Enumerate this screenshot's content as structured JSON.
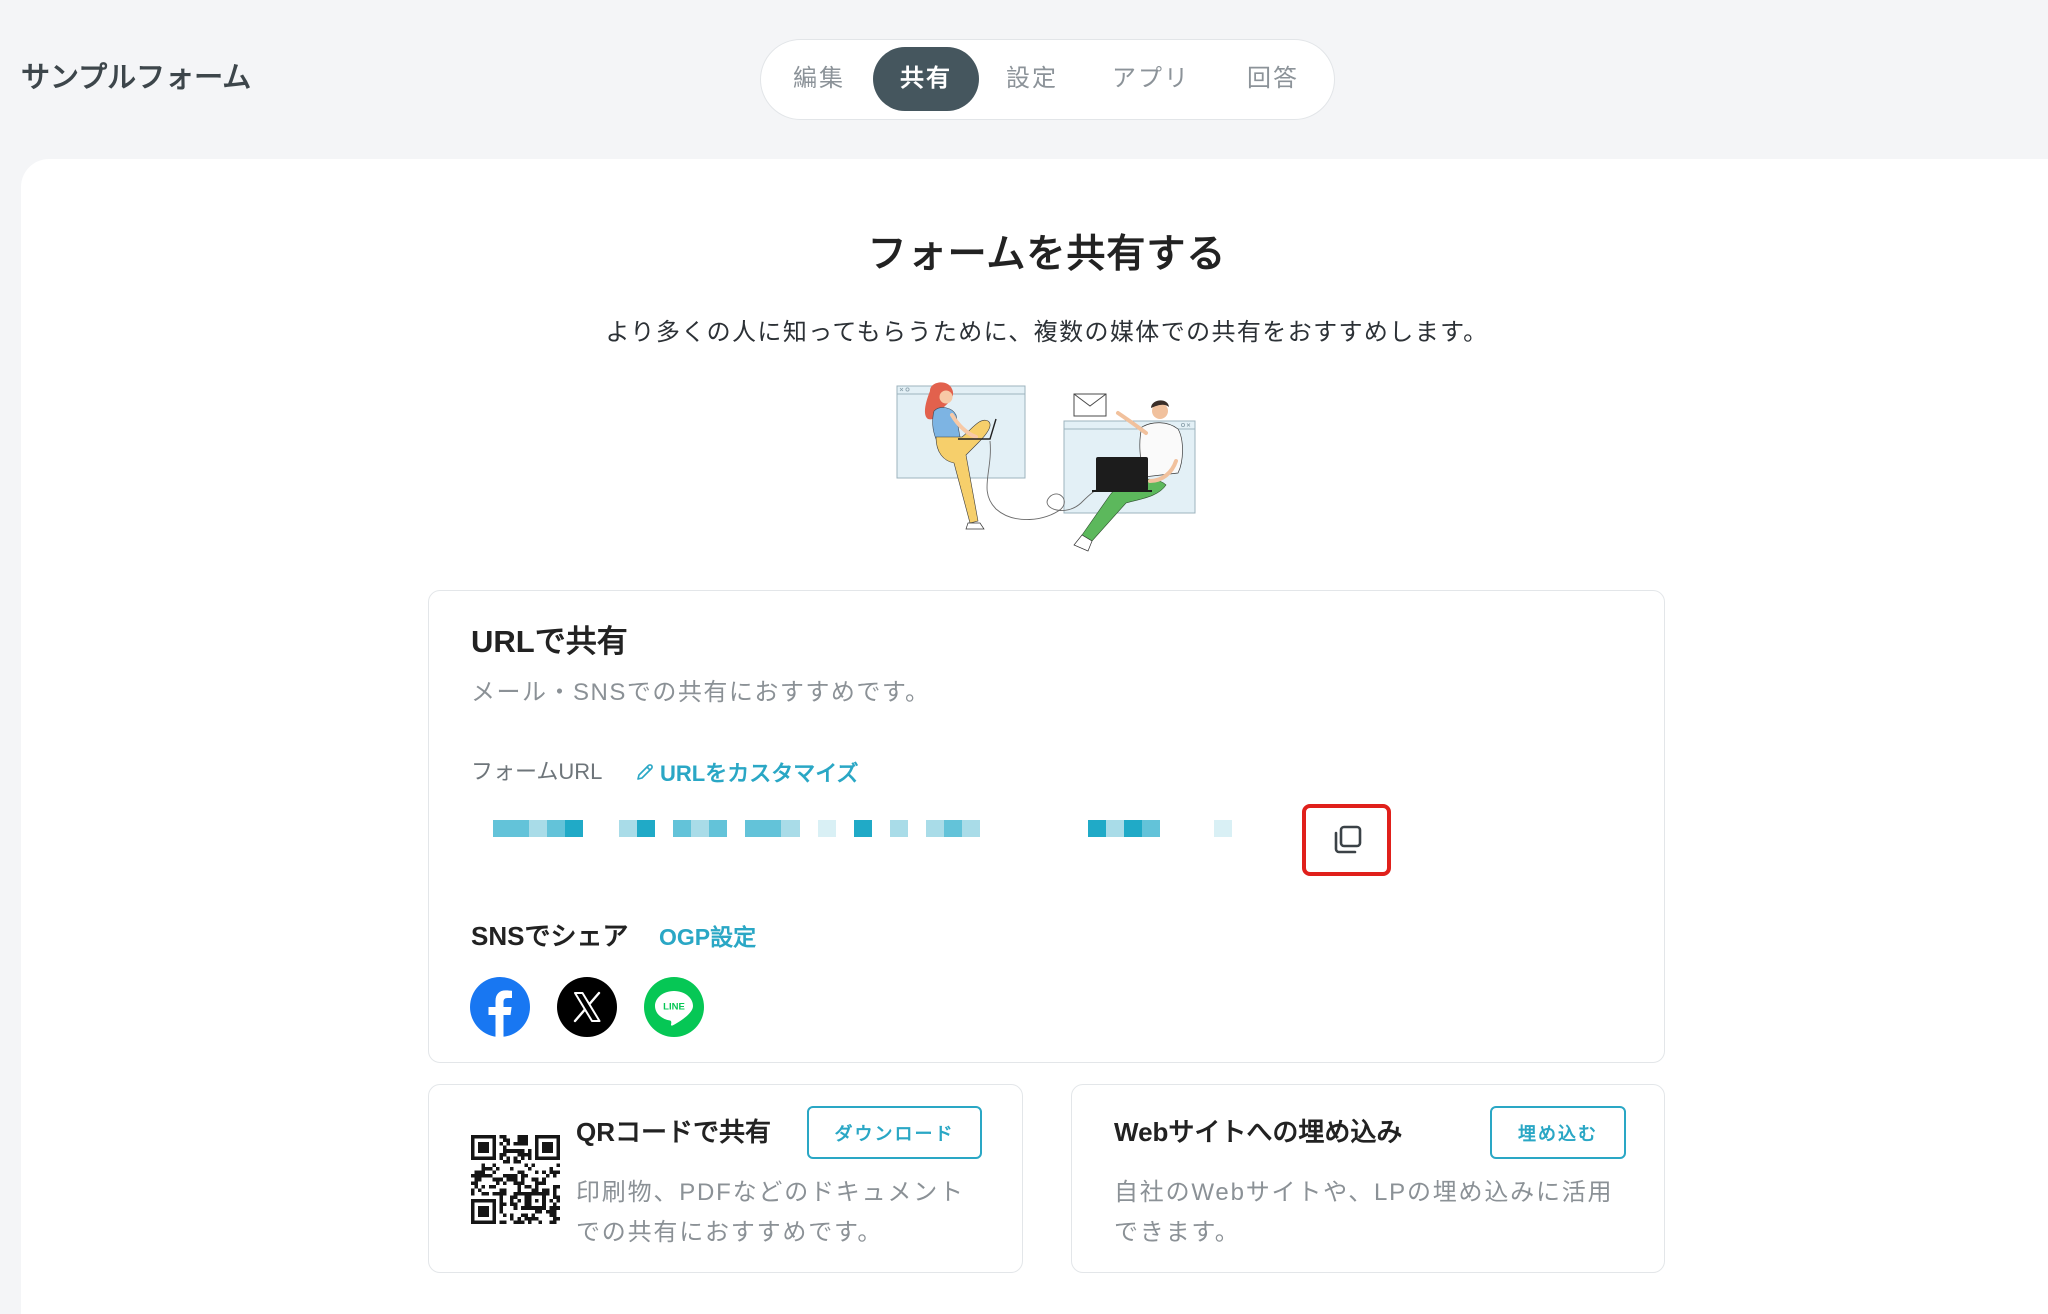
{
  "app": {
    "title": "サンプルフォーム"
  },
  "tabs": [
    {
      "label": "編集",
      "active": false
    },
    {
      "label": "共有",
      "active": true
    },
    {
      "label": "設定",
      "active": false
    },
    {
      "label": "アプリ",
      "active": false
    },
    {
      "label": "回答",
      "active": false
    }
  ],
  "hero": {
    "title": "フォームを共有する",
    "subtitle": "より多くの人に知ってもらうために、複数の媒体での共有をおすすめします。"
  },
  "url_share": {
    "title": "URLで共有",
    "description": "メール・SNSでの共有におすすめです。",
    "form_url_label": "フォームURL",
    "customize_link": "URLをカスタマイズ",
    "customize_icon": "pencil-icon",
    "copy_button": {
      "icon": "copy-icon",
      "highlighted": true
    }
  },
  "sns": {
    "title": "SNSでシェア",
    "ogp_link": "OGP設定",
    "networks": [
      {
        "icon": "facebook-icon"
      },
      {
        "icon": "x-icon"
      },
      {
        "icon": "line-icon",
        "logo_text": "LINE"
      }
    ]
  },
  "qr": {
    "title": "QRコードで共有",
    "button": "ダウンロード",
    "image": "qr-code-image",
    "description_lines": [
      "印刷物、PDFなどのドキュメント",
      "での共有におすすめです。"
    ]
  },
  "embed": {
    "title": "Webサイトへの埋め込み",
    "button": "埋め込む",
    "description_lines": [
      "自社のWebサイトや、LPの埋め込みに活用",
      "できます。"
    ]
  },
  "colors": {
    "accent": "#2aa7c5",
    "active_tab": "#45565e",
    "highlight": "#e0201b",
    "facebook": "#1877f2",
    "x": "#000000",
    "line": "#06c755"
  }
}
